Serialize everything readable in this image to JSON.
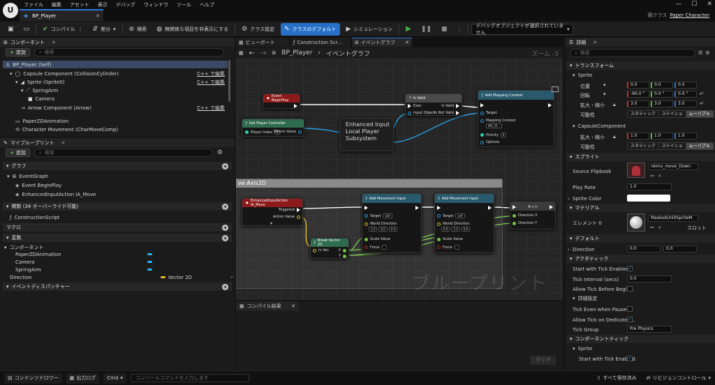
{
  "app": {
    "logo": "U",
    "menu": [
      "ファイル",
      "編集",
      "アセット",
      "表示",
      "デバッグ",
      "ウィンドウ",
      "ツール",
      "ヘルプ"
    ],
    "doc_tab": "BP_Player",
    "parent_class_label": "親クラス",
    "parent_class_value": "Paper Character",
    "window_controls": [
      "—",
      "☐",
      "✕"
    ]
  },
  "toolbar": {
    "compile": "コンパイル",
    "diff": "差分",
    "search": "検索",
    "hide_unrelated": "無関係な項目を非表示にする",
    "class_settings": "クラス設定",
    "class_defaults": "クラスのデフォルト",
    "simulation": "シミュレーション",
    "debug_object": "デバッグオブジェクトが選択されていません"
  },
  "components_panel": {
    "title": "コンポーネント",
    "add": "追加",
    "search_placeholder": "検索",
    "edit_cpp": "C++ で編集",
    "items": [
      "BP_Player (Self)",
      "Capsule Component (CollisionCylinder)",
      "Sprite (Sprite0)",
      "SpringArm",
      "Camera",
      "Arrow Component (Arrow)",
      "PaperZDAnimation",
      "Character Movement (CharMoveComp)"
    ]
  },
  "blueprint_panel": {
    "title": "マイブループリント",
    "add": "追加",
    "search_placeholder": "検索",
    "graph_section": "グラフ",
    "graphs": [
      "EventGraph",
      "Event BeginPlay",
      "EnhancedInputAction IA_Move"
    ],
    "functions_section": "関数 (34 オーバーライド可能)",
    "functions": [
      "ConstructionScript"
    ],
    "macros_section": "マクロ",
    "variables_section": "変数",
    "components_header": "コンポーネント",
    "variables": [
      "PaperZDAnimation",
      "Camera",
      "SpringArm"
    ],
    "direction_var": "Direction",
    "direction_type": "Vector 2D",
    "dispatchers_section": "イベントディスパッチャー"
  },
  "graph_tabs": [
    "ビューポート",
    "Construction Scr...",
    "イベントグラフ"
  ],
  "graph": {
    "breadcrumb_bp": "BP_Player",
    "breadcrumb_graph": "イベントグラフ",
    "zoom": "ズーム -3",
    "watermark": "ブループリント",
    "comment": "ve Axis2D",
    "nodes": {
      "begin_play": "Event BeginPlay",
      "get_pc": "Get Player Controller",
      "player_index_label": "Player Index",
      "player_index_value": "0",
      "return_value": "Return Value",
      "is_valid": "Is Valid",
      "exec": "Exec",
      "is_valid_pin": "Is Valid",
      "is_not_valid": "Is Not Valid",
      "input_object": "Input Object",
      "subsystem": "Enhanced Input Local Player Subsystem",
      "add_mapping": "Add Mapping Context",
      "target": "Target",
      "mapping_context": "Mapping Context",
      "mapping_value": "IMC_Pl...",
      "priority": "Priority",
      "priority_value": "0",
      "options": "Options",
      "ia_move": "EnhancedInputAction IA_Move",
      "triggered": "Triggered",
      "action_value": "Action Value",
      "break_vec": "Break Vector 2D",
      "in_vec": "In Vec",
      "x": "X",
      "y": "Y",
      "add_move1": "Add Movement Input",
      "add_move2": "Add Movement Input",
      "target_self": "self",
      "world_dir": "World Direction",
      "dir1": [
        "1.0",
        "0.0",
        "0.0"
      ],
      "dir2": [
        "0.0",
        "1.0",
        "0.0"
      ],
      "scale_value": "Scale Value",
      "force": "Force",
      "set": "セット",
      "direction_x": "Direction X",
      "direction_y": "Direction Y"
    }
  },
  "compile_results": {
    "tab": "コンパイル結果",
    "clear": "クリア"
  },
  "details": {
    "title": "詳細",
    "search_placeholder": "検索",
    "transform": "トランスフォーム",
    "sprite_sub": "Sprite",
    "location": "位置",
    "location_vals": [
      "0.0",
      "0.0",
      "0.0"
    ],
    "rotation": "回転",
    "rotation_vals": [
      "-90.0 °",
      "0.0 °",
      "0.0 °"
    ],
    "scale": "拡大・縮小",
    "scale_vals": [
      "3.0",
      "3.0",
      "3.0"
    ],
    "mobility": "可動性",
    "mobility_opts": [
      "スタティック",
      "ステイショ",
      "ムーバブル"
    ],
    "capsule_sub": "CapsuleComponent",
    "capsule_scale_vals": [
      "1.0",
      "1.0",
      "1.0"
    ],
    "sprite_section": "スプライト",
    "source_flipbook": "Source Flipbook",
    "flipbook_value": "reimu_move_Down",
    "play_rate": "Play Rate",
    "play_rate_value": "1.0",
    "sprite_color": "Sprite Color",
    "material_section": "マテリアル",
    "element0": "エレメント 0",
    "material_value": "MaskedUnlitSpriteM",
    "slot_label": "スロット",
    "default_section": "デフォルト",
    "direction": "Direction",
    "direction_vals": [
      "0.0",
      "0.0"
    ],
    "activation_section": "アクタティック",
    "start_with_tick": "Start with Tick Enabled",
    "tick_interval": "Tick Interval (secs)",
    "tick_interval_value": "0.0",
    "allow_tick_before": "Allow Tick Before Begin...",
    "advanced": "詳細設定",
    "tick_even_paused": "Tick Even when Paused",
    "allow_tick_dedicated": "Allow Tick on Dedicated...",
    "tick_group": "Tick Group",
    "tick_group_value": "Pre Physics",
    "component_tick_section": "コンポーネントティック",
    "sprite_sub2": "Sprite",
    "start_with_tick2": "Start with Tick Enabled"
  },
  "statusbar": {
    "content_drawer": "コンテンツドロワー",
    "output_log": "出力ログ",
    "cmd": "Cmd",
    "cmd_placeholder": "コンソールコマンドを入力します",
    "save_all": "すべて保存済み",
    "revision": "リビジョンコントロール"
  },
  "colors": {
    "accent": "#2670c8",
    "event_header": "#8c1a1a",
    "function_header": "#28596c",
    "pure_header": "#2f6b4e",
    "exec_wire": "#ffffff",
    "object_wire": "#2a9fe0",
    "float_wire": "#74c246"
  }
}
